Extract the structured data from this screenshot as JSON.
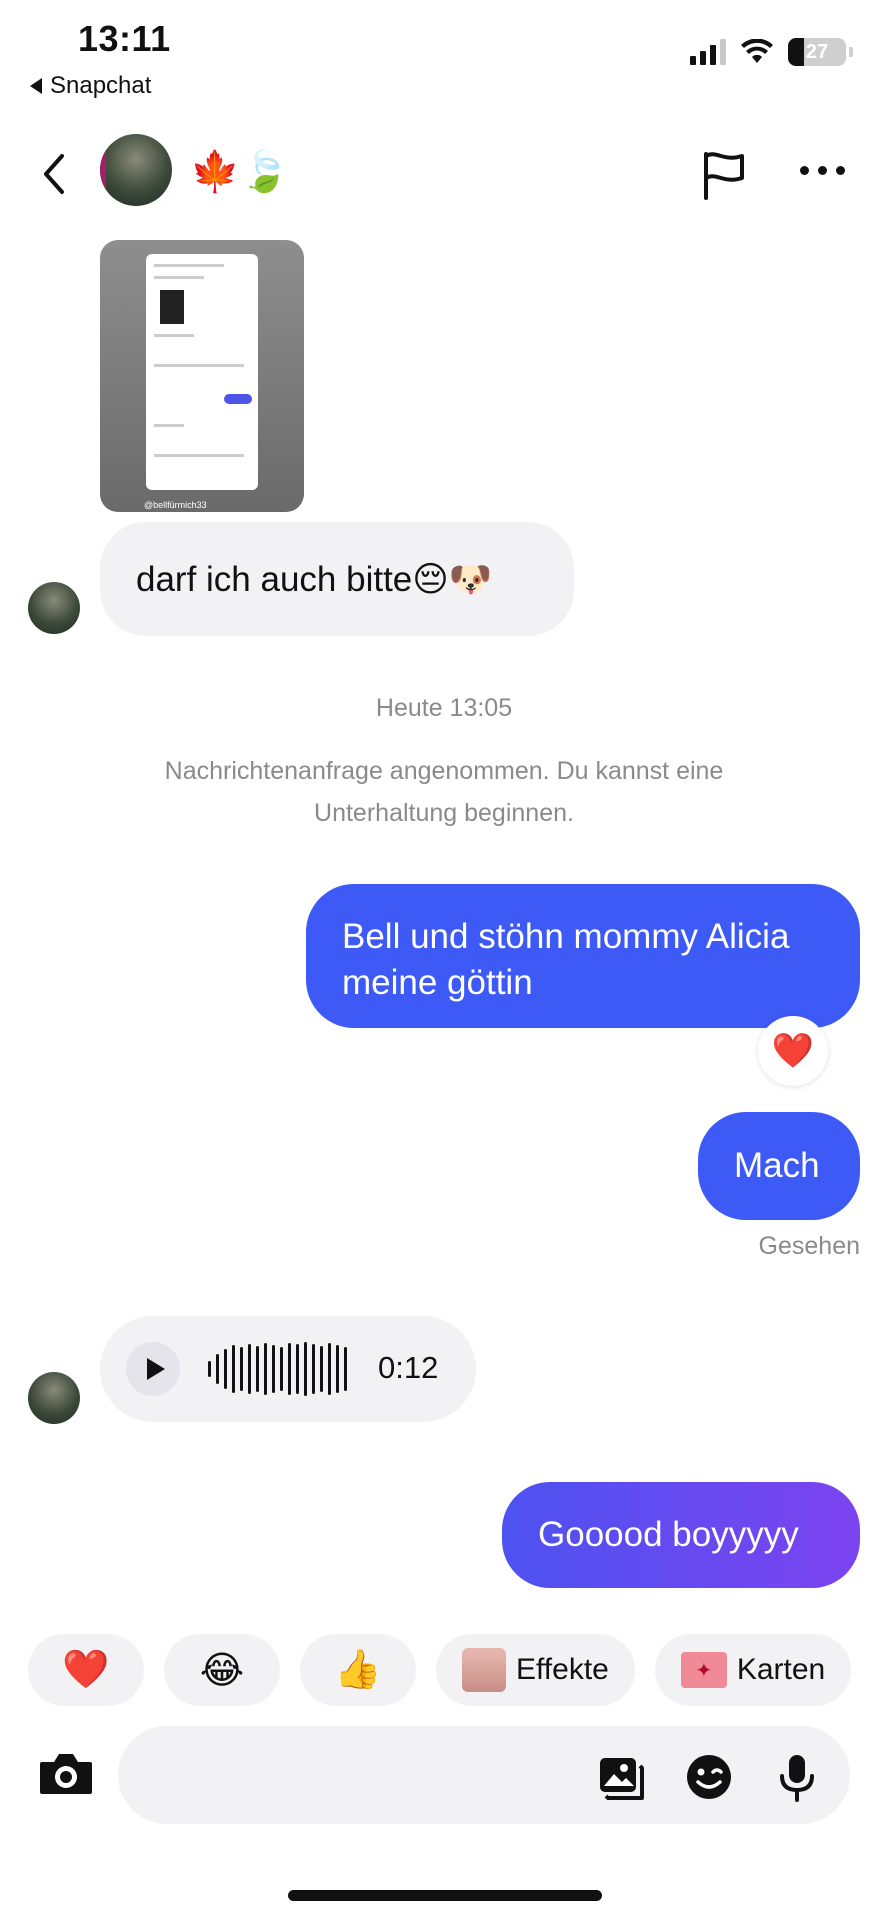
{
  "status_bar": {
    "time": "13:11",
    "back_app": "Snapchat",
    "battery": "27"
  },
  "header": {
    "emoji": "🍁🍃"
  },
  "messages": {
    "image_handle": "@bellfürmich33",
    "incoming_text": "darf ich auch bitte😔🐶",
    "system_time": "Heute 13:05",
    "system_note": "Nachrichtenanfrage angenommen. Du kannst eine Unterhaltung beginnen.",
    "outgoing_1": "Bell und stöhn mommy Alicia meine göttin",
    "reaction_1": "❤️",
    "outgoing_2": "Mach",
    "seen_label": "Gesehen",
    "voice_duration": "0:12",
    "outgoing_3": "Gooood boyyyyy"
  },
  "quick_replies": {
    "heart": "❤️",
    "laugh": "😂",
    "thumbs": "👍",
    "effects": "Effekte",
    "cards": "Karten"
  },
  "composer": {
    "placeholder": ""
  },
  "icons": {
    "back": "chevron-left-icon",
    "report": "flag-icon",
    "more": "more-icon",
    "camera": "camera-icon",
    "gallery": "gallery-icon",
    "sticker": "sticker-icon",
    "mic": "microphone-icon"
  },
  "colors": {
    "outgoing_bubble": "#3d5af6",
    "incoming_bubble": "#f2f2f5",
    "gradient_start": "#4d52f0",
    "gradient_end": "#7c43f0"
  }
}
